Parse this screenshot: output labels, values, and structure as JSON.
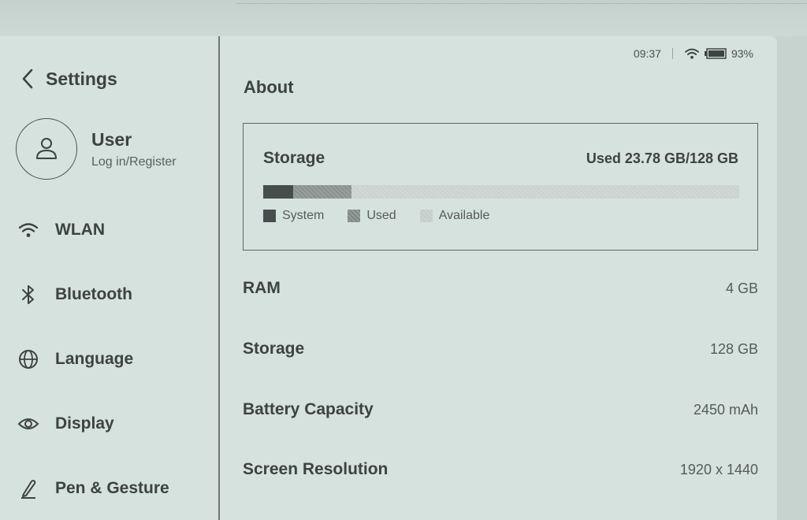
{
  "status": {
    "time": "09:37",
    "battery": "93%"
  },
  "sidebar": {
    "back_label": "Settings",
    "user": {
      "name": "User",
      "sub": "Log in/Register"
    },
    "items": [
      {
        "label": "WLAN",
        "icon": "wifi-icon"
      },
      {
        "label": "Bluetooth",
        "icon": "bluetooth-icon"
      },
      {
        "label": "Language",
        "icon": "globe-icon"
      },
      {
        "label": "Display",
        "icon": "eye-icon"
      },
      {
        "label": "Pen & Gesture",
        "icon": "pen-icon"
      }
    ]
  },
  "main": {
    "title": "About",
    "storage_card": {
      "title": "Storage",
      "used_text": "Used 23.78 GB/128 GB",
      "segments": {
        "system_gb": 8,
        "used_gb": 15.78,
        "total_gb": 128
      },
      "legend": [
        "System",
        "Used",
        "Available"
      ]
    },
    "rows": [
      {
        "key": "RAM",
        "value": "4 GB"
      },
      {
        "key": "Storage",
        "value": "128 GB"
      },
      {
        "key": "Battery Capacity",
        "value": "2450 mAh"
      },
      {
        "key": "Screen Resolution",
        "value": "1920 x 1440"
      }
    ]
  },
  "colors": {
    "screen": "#d6e2de",
    "text": "#3d4242",
    "system": "#474d4d"
  }
}
